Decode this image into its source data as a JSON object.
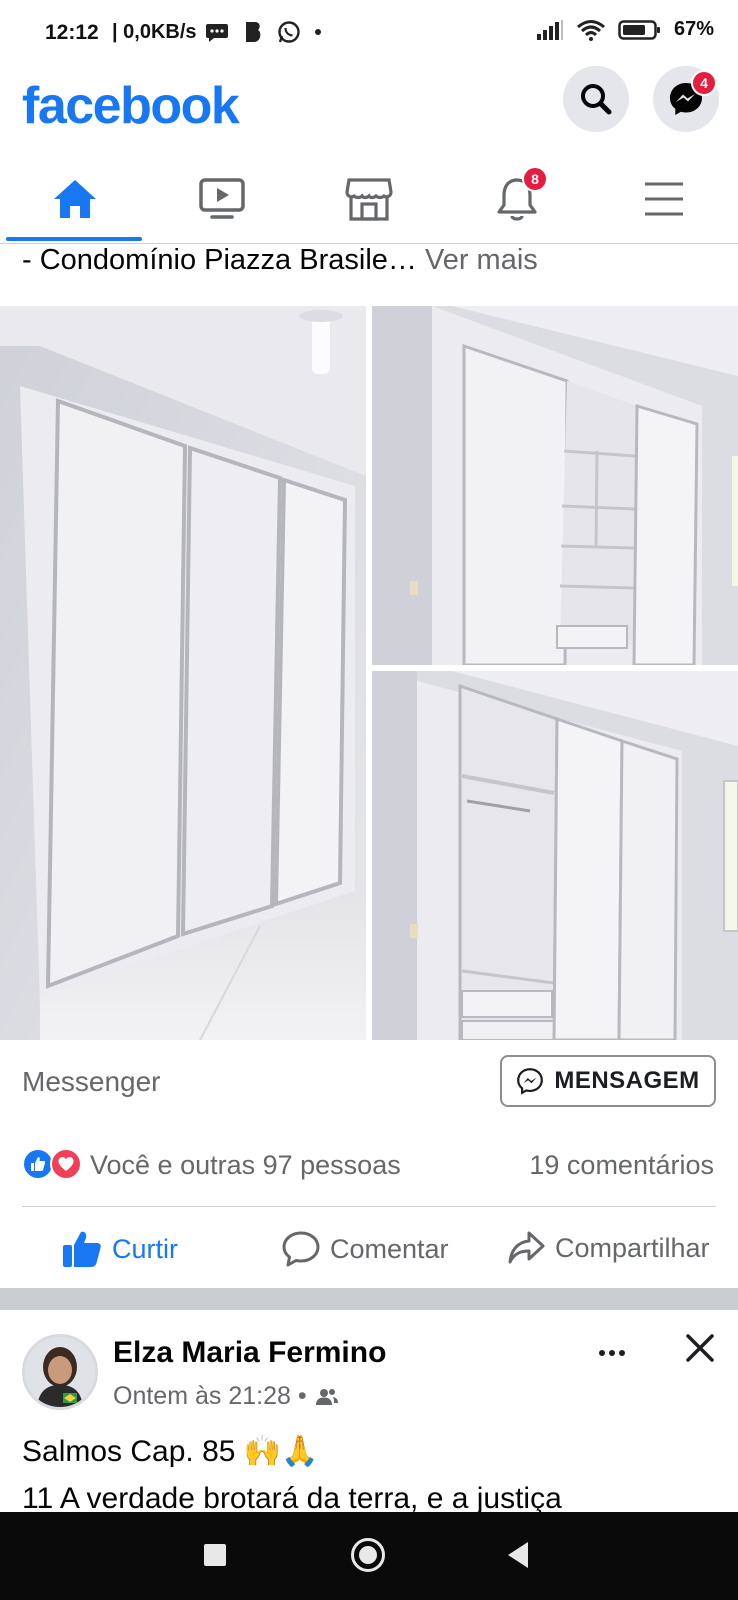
{
  "status_bar": {
    "time": "12:12",
    "network": "| 0,0KB/s",
    "battery": "67%"
  },
  "header": {
    "logo": "facebook",
    "messenger_badge": "4"
  },
  "nav": {
    "notifications_badge": "8",
    "items": [
      "home-icon",
      "video-icon",
      "marketplace-icon",
      "bell-icon",
      "menu-icon"
    ]
  },
  "post": {
    "description": "- Condomínio Piazza Brasile…",
    "see_more": "Ver mais",
    "messenger_label": "Messenger",
    "message_button": "MENSAGEM",
    "reactions_text": "Você e outras 97 pessoas",
    "comments_count": "19 comentários",
    "actions": {
      "like": "Curtir",
      "comment": "Comentar",
      "share": "Compartilhar"
    }
  },
  "post2": {
    "author": "Elza Maria Fermino",
    "time": "Ontem às 21:28 •",
    "text_line1": "Salmos Cap. 85 🙌🙏",
    "text_line2": "11 A verdade brotará da terra, e a justiça"
  },
  "colors": {
    "brand": "#1877f2",
    "badge": "#e41e3f",
    "secondary_text": "#65676b"
  }
}
